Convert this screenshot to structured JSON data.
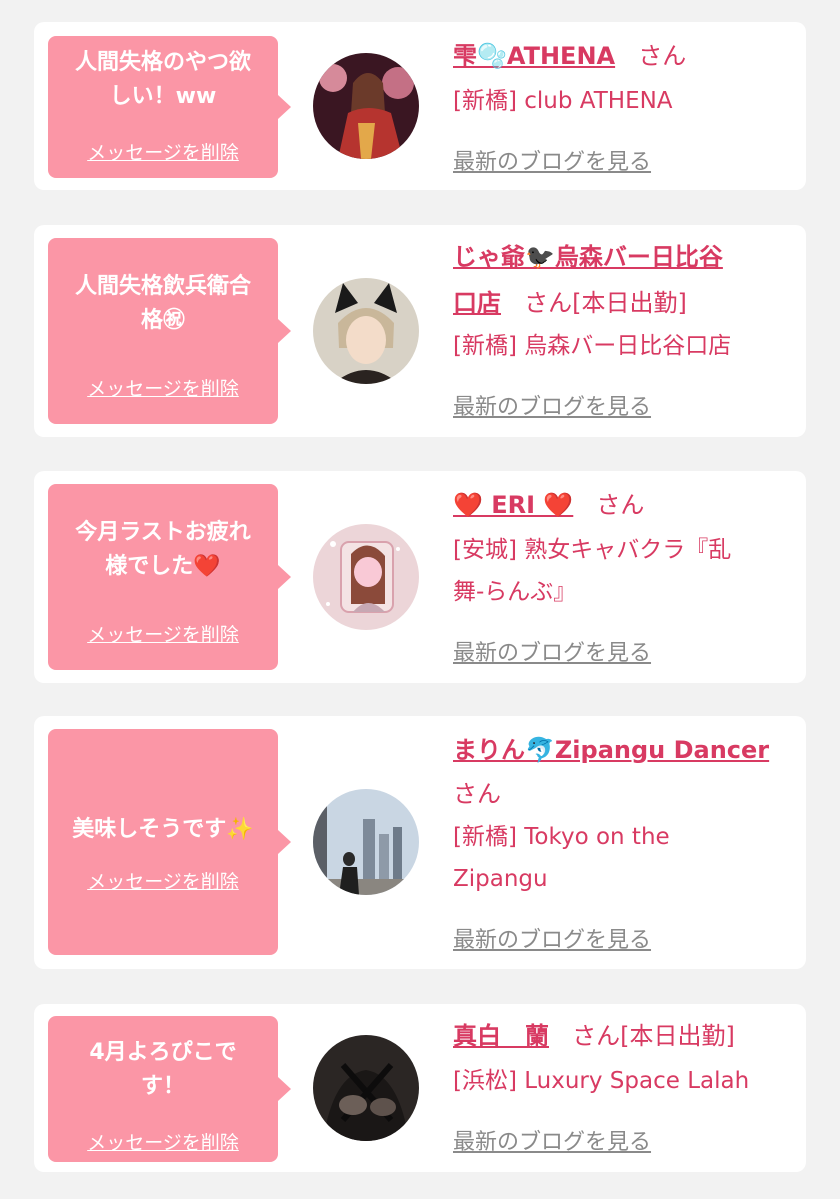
{
  "common": {
    "delete_label": "メッセージを削除",
    "blog_label": "最新のブログを見る",
    "san": "さん"
  },
  "cards": [
    {
      "message": "人間失格のやつ欲しい！ww",
      "message_line1": "人間失格のやつ欲",
      "message_line2": "しい！ww",
      "name": "雫🫧ATHENA",
      "name_suffix": "さん",
      "shop_line1": "[新橋] club ATHENA",
      "avatar_icon": "avatar-photo-kimono-woman"
    },
    {
      "message": "人間失格飲兵衛合格㊗",
      "message_line1": "人間失格飲兵衛合",
      "message_line2": "格㊗",
      "name_line1": "じゃ爺🐦‍⬛烏森バー日比谷",
      "name_line2": "口店",
      "name_suffix": "さん[本日出勤]",
      "shop_line1": "[新橋] 烏森バー日比谷口店",
      "avatar_icon": "avatar-photo-cat-ears"
    },
    {
      "message": "今月ラストお疲れ様でした❤️",
      "message_line1": "今月ラストお疲れ",
      "message_line2": "様でした❤️",
      "name": "❤️ ERI ❤️",
      "name_suffix": "さん",
      "shop_line1": "[安城] 熟女キャバクラ『乱",
      "shop_line2": "舞-らんぶ』",
      "avatar_icon": "avatar-photo-sparkle-frame"
    },
    {
      "message": "美味しそうです✨",
      "message_line1": "美味しそうです✨",
      "name": "まりん🐬Zipangu Dancer",
      "name_suffix": "さん",
      "shop_line1": "[新橋] Tokyo on the",
      "shop_line2": "Zipangu",
      "avatar_icon": "avatar-photo-city-window"
    },
    {
      "message": "4月よろぴこです！",
      "message_line1": "4月よろぴこで",
      "message_line2": "す！",
      "name": "真白　蘭",
      "name_suffix": "さん[本日出勤]",
      "shop_line1": "[浜松] Luxury Space Lalah",
      "avatar_icon": "avatar-photo-dark-outfit"
    }
  ],
  "colors": {
    "background": "#f2f2f2",
    "card": "#ffffff",
    "bubble": "#fb96a6",
    "accent_text": "#d83a62",
    "blog_link": "#8a8a8a"
  }
}
